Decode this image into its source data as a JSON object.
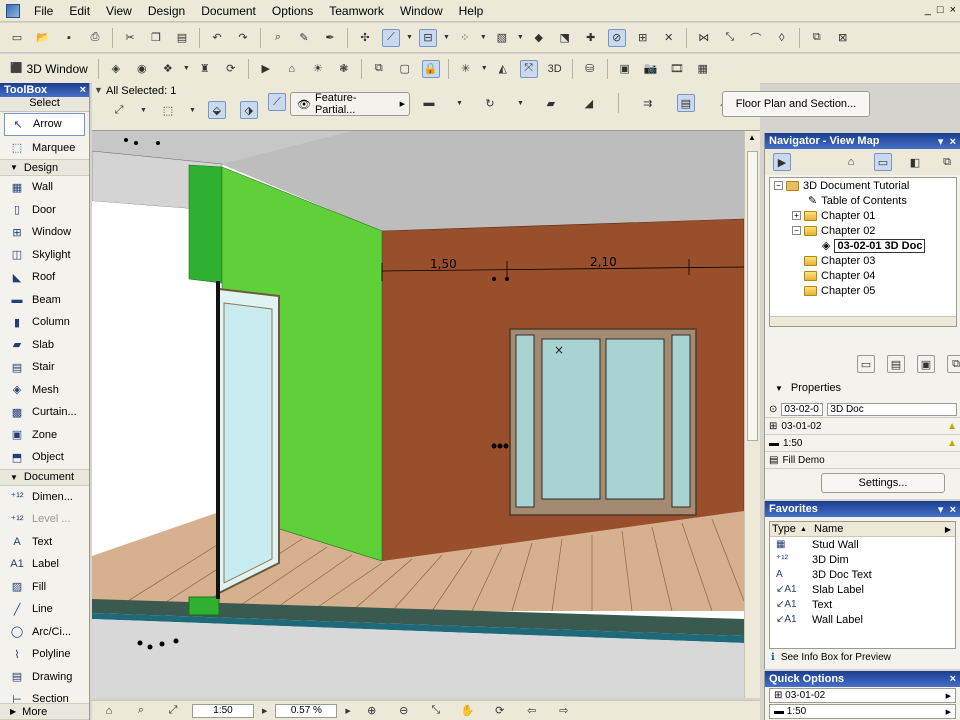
{
  "menu": {
    "items": [
      "File",
      "Edit",
      "View",
      "Design",
      "Document",
      "Options",
      "Teamwork",
      "Window",
      "Help"
    ]
  },
  "window_controls": [
    "_",
    "□",
    "×"
  ],
  "toolbar": {
    "view_3d_label": "3D Window"
  },
  "toolbox": {
    "title": "ToolBox",
    "select_label": "Select",
    "select_tools": [
      {
        "label": "Arrow",
        "icon": "arrow-icon"
      },
      {
        "label": "Marquee",
        "icon": "marquee-icon"
      }
    ],
    "design_group": "Design",
    "design_tools": [
      {
        "label": "Wall",
        "icon": "wall-icon"
      },
      {
        "label": "Door",
        "icon": "door-icon"
      },
      {
        "label": "Window",
        "icon": "window-icon"
      },
      {
        "label": "Skylight",
        "icon": "skylight-icon"
      },
      {
        "label": "Roof",
        "icon": "roof-icon"
      },
      {
        "label": "Beam",
        "icon": "beam-icon"
      },
      {
        "label": "Column",
        "icon": "column-icon"
      },
      {
        "label": "Slab",
        "icon": "slab-icon"
      },
      {
        "label": "Stair",
        "icon": "stair-icon"
      },
      {
        "label": "Mesh",
        "icon": "mesh-icon"
      },
      {
        "label": "Curtain...",
        "icon": "curtain-wall-icon"
      },
      {
        "label": "Zone",
        "icon": "zone-icon"
      },
      {
        "label": "Object",
        "icon": "object-icon"
      }
    ],
    "document_group": "Document",
    "document_tools": [
      {
        "label": "Dimen...",
        "icon": "dimension-icon",
        "glyph": "⁺¹²"
      },
      {
        "label": "Level ...",
        "icon": "level-dimension-icon",
        "glyph": "⁺¹²"
      },
      {
        "label": "Text",
        "icon": "text-icon",
        "glyph": "A"
      },
      {
        "label": "Label",
        "icon": "label-icon",
        "glyph": "A1"
      },
      {
        "label": "Fill",
        "icon": "fill-icon",
        "glyph": "▨"
      },
      {
        "label": "Line",
        "icon": "line-icon",
        "glyph": "╱"
      },
      {
        "label": "Arc/Ci...",
        "icon": "arc-icon",
        "glyph": "◯"
      },
      {
        "label": "Polyline",
        "icon": "polyline-icon",
        "glyph": "⌇"
      },
      {
        "label": "Drawing",
        "icon": "drawing-icon",
        "glyph": "▤"
      },
      {
        "label": "Section",
        "icon": "section-icon",
        "glyph": "⊢"
      }
    ],
    "more_label": "More"
  },
  "infobox": {
    "all_selected": "All Selected: 1",
    "feature_label": "Feature-Partial...",
    "floor_plan_button": "Floor Plan and Section..."
  },
  "viewport": {
    "dim_1": "1,50",
    "dim_2": "2,10"
  },
  "statusbar": {
    "scale": "1:50",
    "zoom": "0.57 %"
  },
  "navigator": {
    "title": "Navigator - View Map",
    "root": "3D Document Tutorial",
    "toc": "Table of Contents",
    "chapters": [
      "Chapter 01",
      "Chapter 02",
      "Chapter 03",
      "Chapter 04",
      "Chapter 05"
    ],
    "selected_doc": "03-02-01 3D Doc",
    "properties_label": "Properties",
    "prop_id": "03-02-0",
    "prop_name": "3D Doc",
    "prop_ref": "03-01-02",
    "prop_scale": "1:50",
    "prop_fill": "Fill Demo",
    "settings_button": "Settings..."
  },
  "favorites": {
    "title": "Favorites",
    "col_type": "Type",
    "col_name": "Name",
    "items": [
      {
        "name": "Stud Wall",
        "glyph": "▦",
        "icon": "wall-favorite-icon"
      },
      {
        "name": "3D Dim",
        "glyph": "⁺¹²",
        "icon": "dimension-favorite-icon"
      },
      {
        "name": "3D Doc Text",
        "glyph": "A",
        "icon": "text-favorite-icon"
      },
      {
        "name": "Slab Label",
        "glyph": "↙A1",
        "icon": "label-favorite-icon"
      },
      {
        "name": "Text",
        "glyph": "↙A1",
        "icon": "label-favorite-icon"
      },
      {
        "name": "Wall Label",
        "glyph": "↙A1",
        "icon": "label-favorite-icon"
      }
    ],
    "info_hint": "See Info Box for Preview"
  },
  "quick_options": {
    "title": "Quick Options",
    "layer_value": "03-01-02",
    "scale_value": "1:50"
  },
  "colors": {
    "title_bar": "#1b3d8f",
    "green_wall": "#5fd03a",
    "brown_wall": "#9a4f2c",
    "deck": "#c8a080"
  }
}
